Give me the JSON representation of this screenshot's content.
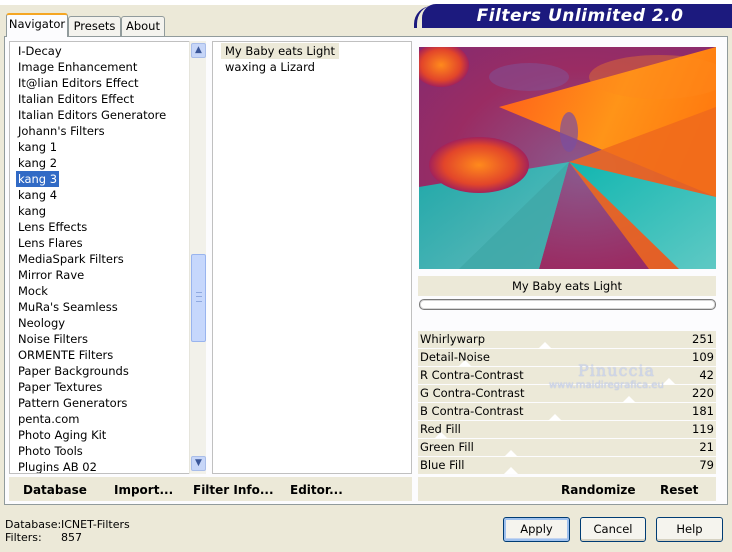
{
  "banner": {
    "title": "Filters Unlimited 2.0"
  },
  "tabs": [
    {
      "label": "Navigator",
      "active": true
    },
    {
      "label": "Presets",
      "active": false
    },
    {
      "label": "About",
      "active": false
    }
  ],
  "categories": {
    "items": [
      "I-Decay",
      "Image Enhancement",
      "It@lian Editors Effect",
      "Italian Editors Effect",
      "Italian Editors Generatore",
      "Johann's Filters",
      "kang 1",
      "kang 2",
      "kang 3",
      "kang 4",
      "kang",
      "Lens Effects",
      "Lens Flares",
      "MediaSpark Filters",
      "Mirror Rave",
      "Mock",
      "MuRa's Seamless",
      "Neology",
      "Noise Filters",
      "ORMENTE Filters",
      "Paper Backgrounds",
      "Paper Textures",
      "Pattern Generators",
      "penta.com",
      "Photo Aging Kit",
      "Photo Tools",
      "Plugins AB 02"
    ],
    "selected": "kang 3"
  },
  "filters": {
    "items": [
      "My Baby eats Light",
      "waxing a Lizard"
    ],
    "selected": "My Baby eats Light"
  },
  "preview": {
    "filter_name": "My Baby eats Light"
  },
  "sliders": [
    {
      "label": "Whirlywarp",
      "value": "251"
    },
    {
      "label": "Detail-Noise",
      "value": "109"
    },
    {
      "label": "R Contra-Contrast",
      "value": "42"
    },
    {
      "label": "G Contra-Contrast",
      "value": "220"
    },
    {
      "label": "B Contra-Contrast",
      "value": "181"
    },
    {
      "label": "Red Fill",
      "value": "119"
    },
    {
      "label": "Green Fill",
      "value": "21"
    },
    {
      "label": "Blue Fill",
      "value": "79"
    }
  ],
  "watermark": {
    "name": "Pinuccia",
    "site": "www.maidiregrafica.eu"
  },
  "toolbar_left": {
    "database": "Database",
    "import": "Import...",
    "filter_info": "Filter Info...",
    "editor": "Editor..."
  },
  "toolbar_right": {
    "randomize": "Randomize",
    "reset": "Reset"
  },
  "status": {
    "database_label": "Database:",
    "database_value": "ICNET-Filters",
    "filters_label": "Filters:",
    "filters_value": "857"
  },
  "buttons": {
    "apply": "Apply",
    "cancel": "Cancel",
    "help": "Help"
  },
  "colors": {
    "banner": "#1c1a7e",
    "selection": "#316ac5",
    "dialog_bg": "#ece9d8",
    "active_tab_accent": "#f5a623"
  }
}
